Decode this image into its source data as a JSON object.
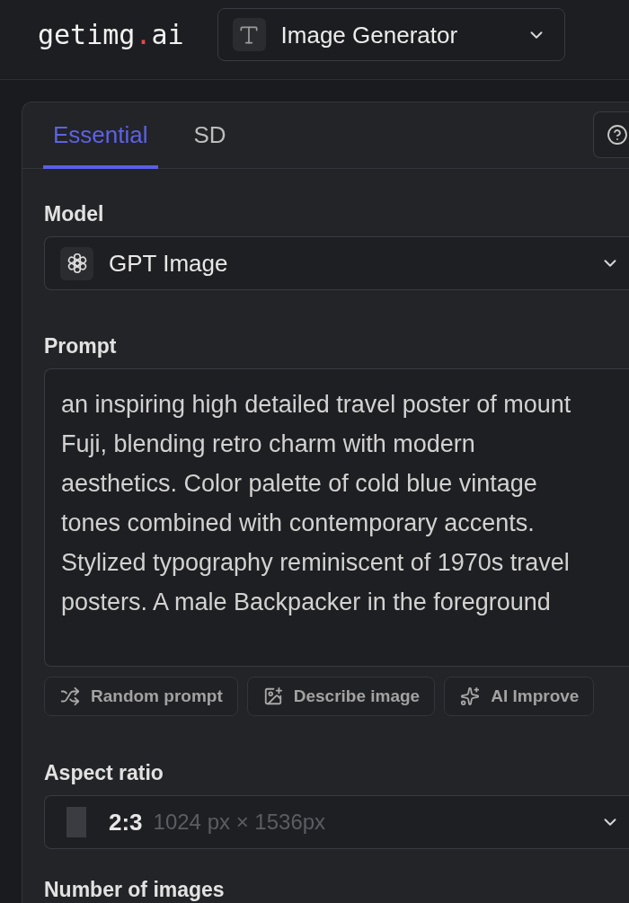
{
  "header": {
    "logo": {
      "name": "getimg",
      "dot": ".",
      "suffix": "ai"
    },
    "tool_select": {
      "value": "Image Generator"
    }
  },
  "panel": {
    "tabs": [
      {
        "label": "Essential",
        "selected": true
      },
      {
        "label": "SD",
        "selected": false
      }
    ],
    "model": {
      "label": "Model",
      "value": "GPT Image"
    },
    "prompt": {
      "label": "Prompt",
      "value": "an inspiring high detailed travel poster of mount Fuji, blending retro charm with modern aesthetics. Color palette of cold blue vintage tones combined with contemporary accents. Stylized typography reminiscent of 1970s travel posters. A male Backpacker in the foreground",
      "actions": [
        "Random prompt",
        "Describe image",
        "AI Improve"
      ]
    },
    "aspect_ratio": {
      "label": "Aspect ratio",
      "ratio": "2:3",
      "size": "1024 px × 1536px"
    },
    "number_of_images": {
      "label": "Number of images"
    }
  }
}
